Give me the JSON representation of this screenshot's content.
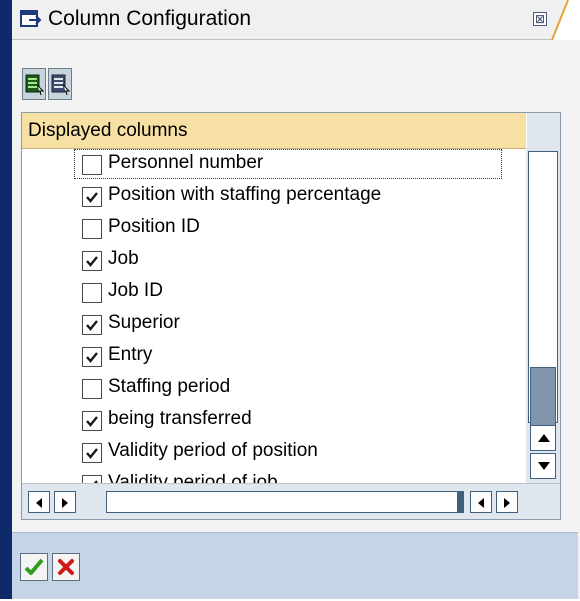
{
  "window": {
    "title": "Column Configuration",
    "close_glyph": "⊠"
  },
  "toolbar": {
    "buttons": [
      {
        "name": "select-all",
        "icon": "select-all-icon"
      },
      {
        "name": "deselect-all",
        "icon": "deselect-all-icon"
      }
    ]
  },
  "table": {
    "header": "Displayed columns",
    "rows": [
      {
        "label": "Personnel number",
        "checked": false,
        "focused": true
      },
      {
        "label": "Position with staffing percentage",
        "checked": true
      },
      {
        "label": "Position ID",
        "checked": false
      },
      {
        "label": "Job",
        "checked": true
      },
      {
        "label": "Job ID",
        "checked": false
      },
      {
        "label": "Superior",
        "checked": true
      },
      {
        "label": "Entry",
        "checked": true
      },
      {
        "label": "Staffing period",
        "checked": false
      },
      {
        "label": "being transferred",
        "checked": true
      },
      {
        "label": "Validity period of position",
        "checked": true
      },
      {
        "label": "Validity period of job",
        "checked": true
      }
    ]
  },
  "footer": {
    "confirm_icon": "check-icon",
    "cancel_icon": "cancel-x-icon"
  },
  "colors": {
    "frame": "#0f2a6a",
    "header": "#f6e0a4",
    "footer": "#c5d4e6",
    "confirm": "#2e9e1c",
    "cancel": "#d01818"
  }
}
